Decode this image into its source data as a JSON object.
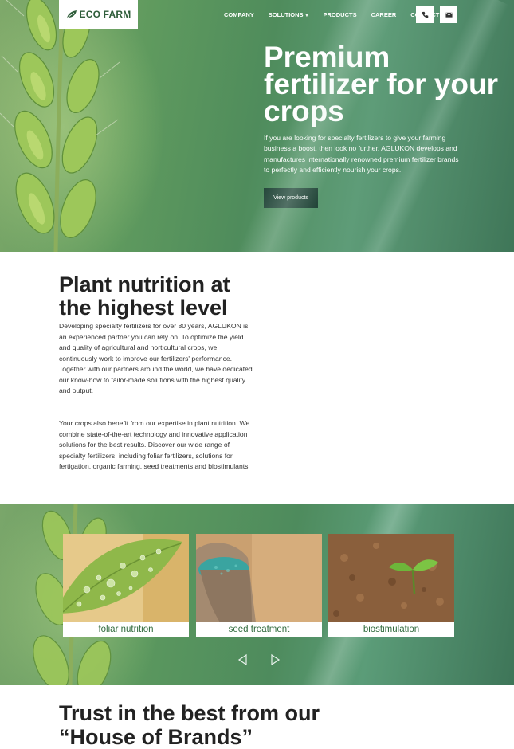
{
  "header": {
    "logo_text": "ECO FARM",
    "nav": [
      "COMPANY",
      "SOLUTIONS",
      "PRODUCTS",
      "CAREER",
      "CONTACT"
    ],
    "phone_icon": "phone-icon",
    "mail_icon": "envelope-icon"
  },
  "hero": {
    "title": "Premium fertilizer for your crops",
    "text": "If you are looking for specialty fertilizers to give your farming business a boost, then look no further. AGLUKON develops and manufactures internationally renowned premium fertilizer brands to perfectly and efficiently nourish your crops.",
    "cta": "View products"
  },
  "intro": {
    "title": "Plant nutrition at the highest level",
    "paragraph1": "Developing specialty fertilizers for over 80 years, AGLUKON is an experienced partner you can rely on. To optimize the yield and quality of agricultural and horticultural crops, we continuously work to improve our fertilizers' performance. Together with our partners around the world, we have dedicated our know-how to tailor-made solutions with the highest quality and output.",
    "paragraph2": "Your crops also benefit from our expertise in plant nutrition. We combine state-of-the-art technology and innovative application solutions for the best results. Discover our wide range of specialty fertilizers, including foliar fertilizers, solutions for fertigation, organic farming, seed treatments and biostimulants."
  },
  "solutions": {
    "cards": [
      {
        "caption": "foliar nutrition"
      },
      {
        "caption": "seed treatment"
      },
      {
        "caption": "biostimulation"
      }
    ],
    "prev_icon": "chevron-left-icon",
    "next_icon": "chevron-right-icon"
  },
  "brands": {
    "title": "Trust in the best from our “House of Brands”"
  },
  "colors": {
    "brand_green": "#2f5d3a",
    "cta_bg": "#24463a",
    "caption_green": "#2f6a3c"
  }
}
